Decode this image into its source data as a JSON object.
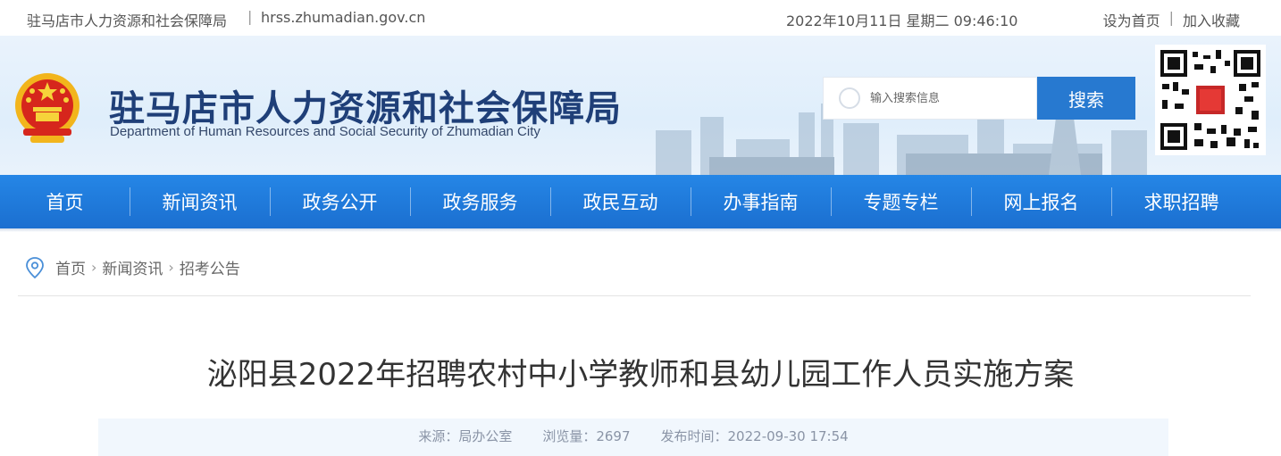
{
  "topbar": {
    "site_name": "驻马店市人力资源和社会保障局",
    "separator": "|",
    "domain": "hrss.zhumadian.gov.cn",
    "datetime": "2022年10月11日 星期二 09:46:10",
    "set_home": "设为首页",
    "link_sep": "|",
    "bookmark": "加入收藏"
  },
  "header": {
    "title_cn": "驻马店市人力资源和社会保障局",
    "title_en": "Department of Human Resources and Social Security of Zhumadian City",
    "search_placeholder": "输入搜索信息",
    "search_button": "搜索",
    "emblem_icon": "national-emblem-icon",
    "qr_icon": "qr-code-icon"
  },
  "nav": {
    "items": [
      "首页",
      "新闻资讯",
      "政务公开",
      "政务服务",
      "政民互动",
      "办事指南",
      "专题专栏",
      "网上报名",
      "求职招聘"
    ]
  },
  "breadcrumb": {
    "items": [
      "首页",
      "新闻资讯",
      "招考公告"
    ],
    "separator": "›"
  },
  "article": {
    "title": "泌阳县2022年招聘农村中小学教师和县幼儿园工作人员实施方案",
    "source": "来源：局办公室",
    "views": "浏览量：2697",
    "published": "发布时间：2022-09-30 17:54"
  },
  "colors": {
    "nav_blue": "#1f7ad9",
    "title_navy": "#1f3f78",
    "search_blue": "#2779d0",
    "meta_bg": "#f1f7fd"
  }
}
